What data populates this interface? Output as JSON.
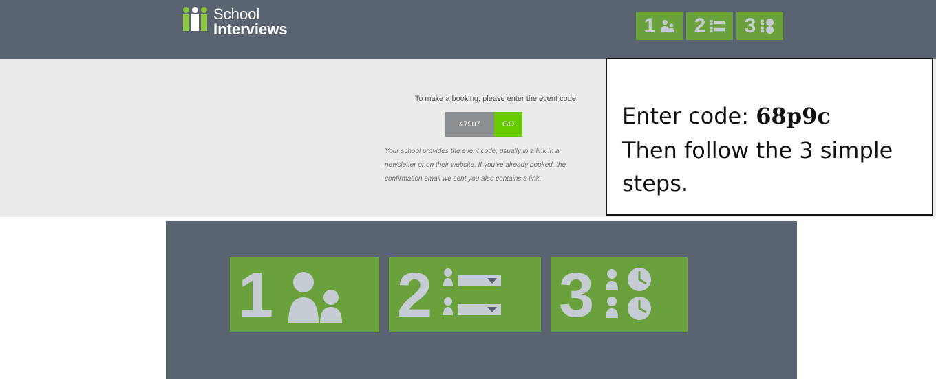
{
  "header": {
    "logo": {
      "line1": "School",
      "line2": "Interviews"
    },
    "steps": [
      {
        "number": "1",
        "icon": "two-people-icon"
      },
      {
        "number": "2",
        "icon": "people-dropdown-list-icon"
      },
      {
        "number": "3",
        "icon": "people-clock-icon"
      }
    ]
  },
  "booking": {
    "prompt": "To make a booking, please enter the event code:",
    "code_value": "479u7",
    "go_label": "GO",
    "help": "Your school provides the event code, usually in a link in a newsletter or on their website. If you've already booked, the confirmation email we sent you also contains a link."
  },
  "note": {
    "enter_label": "Enter code: ",
    "code": "68p9c",
    "line2": "Then follow the 3 simple",
    "line3": "steps."
  },
  "large_steps": [
    {
      "number": "1",
      "icon": "two-people-icon"
    },
    {
      "number": "2",
      "icon": "people-dropdown-list-icon"
    },
    {
      "number": "3",
      "icon": "people-clock-icon"
    }
  ],
  "colors": {
    "header_bg": "#5a6470",
    "panel_bg": "#ebebea",
    "step_green": "#6aa13c",
    "go_green": "#66cc00",
    "input_grey": "#8b8e91",
    "icon_grey": "#c5ccd4",
    "logo_green": "#8dc63f"
  }
}
